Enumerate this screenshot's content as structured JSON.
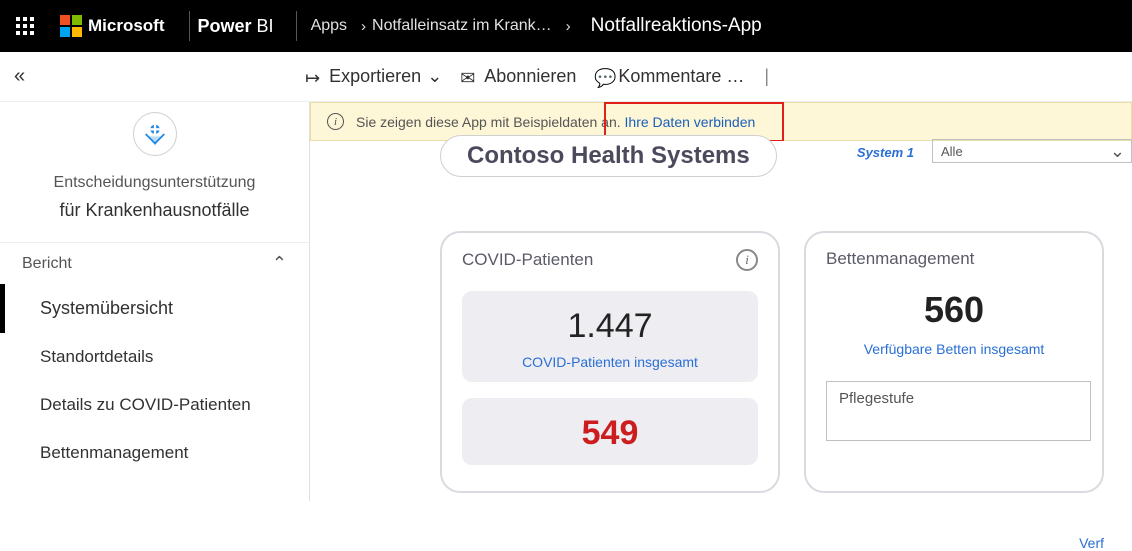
{
  "header": {
    "brand": "Microsoft",
    "product_a": "Power",
    "product_b": "BI",
    "crumb1": "Apps",
    "crumb2": "Notfalleinsatz im Krank…",
    "current": "Notfallreaktions-App"
  },
  "toolbar": {
    "export": "Exportieren",
    "subscribe": "Abonnieren",
    "comments": "Kommentare …"
  },
  "sidebar": {
    "app_title_line1": "Entscheidungsunterstützung",
    "app_title_line2": "für Krankenhausnotfälle",
    "section": "Bericht",
    "items": [
      "Systemübersicht",
      "Standortdetails",
      "Details zu COVID-Patienten",
      "Bettenmanagement"
    ]
  },
  "banner": {
    "text": "Sie zeigen diese App mit Beispieldaten an.",
    "link": "Ihre Daten verbinden"
  },
  "report": {
    "title": "Contoso Health Systems",
    "system_label": "System 1",
    "dropdown_value": "Alle",
    "covid": {
      "head": "COVID-Patienten",
      "total_value": "1.447",
      "total_label": "COVID-Patienten insgesamt",
      "positive_value": "549"
    },
    "beds": {
      "head": "Bettenmanagement",
      "value": "560",
      "label": "Verfügbare Betten insgesamt",
      "side": "Verf"
    },
    "care_label": "Pflegestufe"
  }
}
